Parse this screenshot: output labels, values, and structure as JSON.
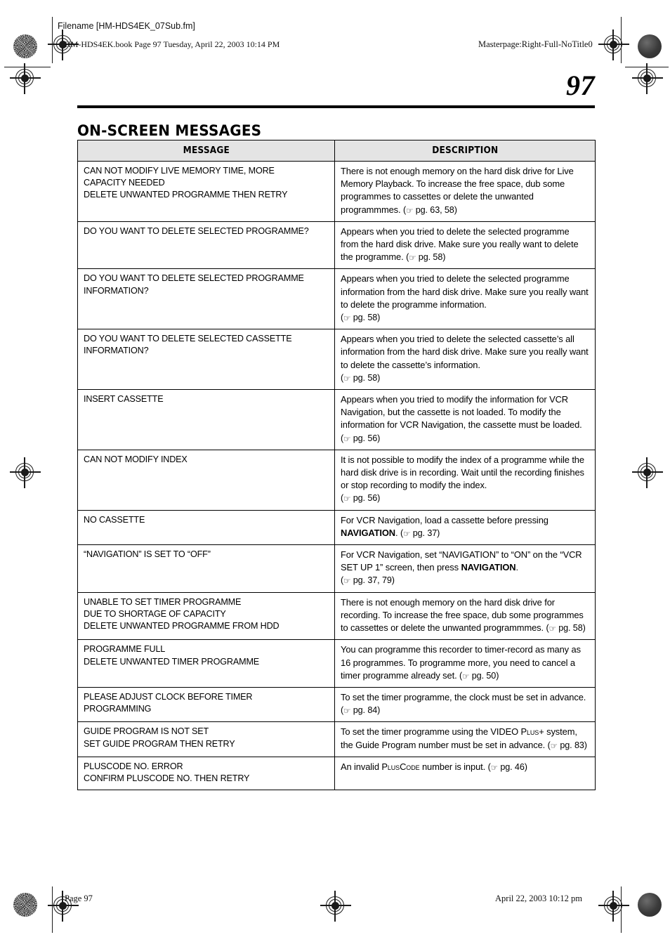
{
  "page": {
    "filename_note": "Filename [HM-HDS4EK_07Sub.fm]",
    "book_note": "HM-HDS4EK.book  Page 97  Tuesday, April 22, 2003  10:14 PM",
    "masterpage_note": "Masterpage:Right-Full-NoTitle0",
    "folio": "97",
    "section_title": "ON-SCREEN MESSAGES",
    "footer_page": "Page 97",
    "footer_timestamp": "April 22, 2003 10:12 pm"
  },
  "icons": {
    "pointing_hand": "☞"
  },
  "table": {
    "columns": [
      "MESSAGE",
      "DESCRIPTION"
    ],
    "rows": [
      {
        "message_lines": [
          "CAN NOT MODIFY LIVE MEMORY TIME, MORE",
          "CAPACITY NEEDED",
          "DELETE UNWANTED PROGRAMME THEN RETRY"
        ],
        "description": "There is not enough memory on the hard disk drive for Live Memory Playback. To increase the free space, dub some programmes to cassettes or delete the unwanted programmmes.",
        "reference": "pg. 63, 58"
      },
      {
        "message_lines": [
          "DO YOU WANT TO DELETE SELECTED PROGRAMME?"
        ],
        "description": "Appears when you tried to delete the selected programme from the hard disk drive. Make sure you really want to delete the programme.",
        "reference": "pg. 58"
      },
      {
        "message_lines": [
          "DO YOU WANT TO DELETE SELECTED PROGRAMME",
          "INFORMATION?"
        ],
        "description": "Appears when you tried to delete the selected programme information from the hard disk drive. Make sure you really want to delete the programme information.",
        "reference": "pg. 58",
        "reference_own_line": true
      },
      {
        "message_lines": [
          "DO YOU WANT TO DELETE SELECTED CASSETTE",
          "INFORMATION?"
        ],
        "description": "Appears when you tried to delete the selected cassette’s all information from the hard disk drive. Make sure you really want to delete the cassette’s information.",
        "reference": "pg. 58",
        "reference_own_line": true
      },
      {
        "message_lines": [
          "INSERT CASSETTE"
        ],
        "description": "Appears when you tried to modify the information for VCR Navigation, but the cassette is not loaded. To modify the information for VCR Navigation, the cassette must be loaded.",
        "reference": "pg. 56"
      },
      {
        "message_lines": [
          "CAN NOT MODIFY INDEX"
        ],
        "description": "It is not possible to modify the index of a programme while the hard disk drive is in recording. Wait until the recording finishes or stop recording to modify the index.",
        "reference": "pg. 56",
        "reference_own_line": true
      },
      {
        "message_lines": [
          "NO CASSETTE"
        ],
        "description_pre": "For VCR Navigation, load a cassette before pressing ",
        "description_bold": "NAVIGATION",
        "description_post": ".",
        "reference": "pg. 37"
      },
      {
        "message_lines": [
          "“NAVIGATION” IS SET TO “OFF”"
        ],
        "description_pre": "For VCR Navigation, set “NAVIGATION” to “ON” on the “VCR SET UP 1” screen, then press ",
        "description_bold": "NAVIGATION",
        "description_post": ".",
        "reference": "pg. 37, 79",
        "reference_own_line": true
      },
      {
        "message_lines": [
          "UNABLE TO SET TIMER PROGRAMME",
          "DUE TO SHORTAGE OF CAPACITY",
          "DELETE UNWANTED PROGRAMME FROM HDD"
        ],
        "description": "There is not enough memory on the hard disk drive for recording. To increase the free space, dub some programmes to cassettes or delete the unwanted programmmes.",
        "reference": "pg. 58"
      },
      {
        "message_lines": [
          "PROGRAMME FULL",
          "DELETE UNWANTED TIMER PROGRAMME"
        ],
        "description": "You can programme this recorder to timer-record as many as 16 programmes. To programme more, you need to cancel a timer programme already set.",
        "reference": "pg. 50"
      },
      {
        "message_lines": [
          "PLEASE ADJUST CLOCK BEFORE TIMER",
          "PROGRAMMING"
        ],
        "description": "To set the timer programme, the clock must be set in advance.",
        "reference": "pg. 84"
      },
      {
        "message_lines": [
          "GUIDE PROGRAM IS NOT SET",
          "SET GUIDE PROGRAM THEN RETRY"
        ],
        "description_pre": "To set the timer programme using the VIDEO ",
        "description_smallcaps": "Plus+",
        "description_post": " system, the Guide Program number must be set in advance.",
        "reference": "pg. 83"
      },
      {
        "message_lines": [
          "PLUSCODE NO. ERROR",
          "CONFIRM PLUSCODE NO. THEN RETRY"
        ],
        "description_pre": "An invalid ",
        "description_smallcaps": "PlusCode",
        "description_post": " number is input.",
        "reference": "pg. 46"
      }
    ]
  }
}
